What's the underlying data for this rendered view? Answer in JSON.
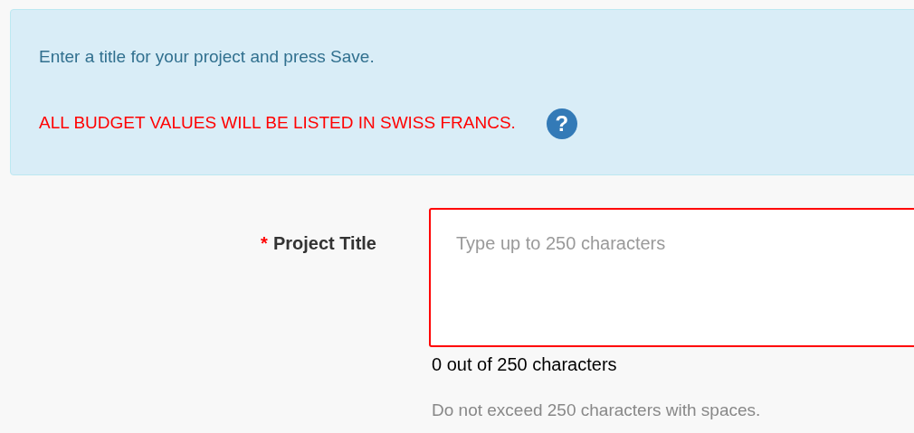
{
  "notice": {
    "message": "Enter a title for your project and press Save.",
    "warning": "ALL BUDGET VALUES WILL BE LISTED IN SWISS FRANCS.",
    "help_icon": "?"
  },
  "field": {
    "required_mark": "*",
    "label": "Project Title",
    "placeholder": "Type up to 250 characters",
    "invalid": true,
    "counter": "0 out of 250 characters",
    "hint": "Do not exceed 250 characters with spaces."
  }
}
